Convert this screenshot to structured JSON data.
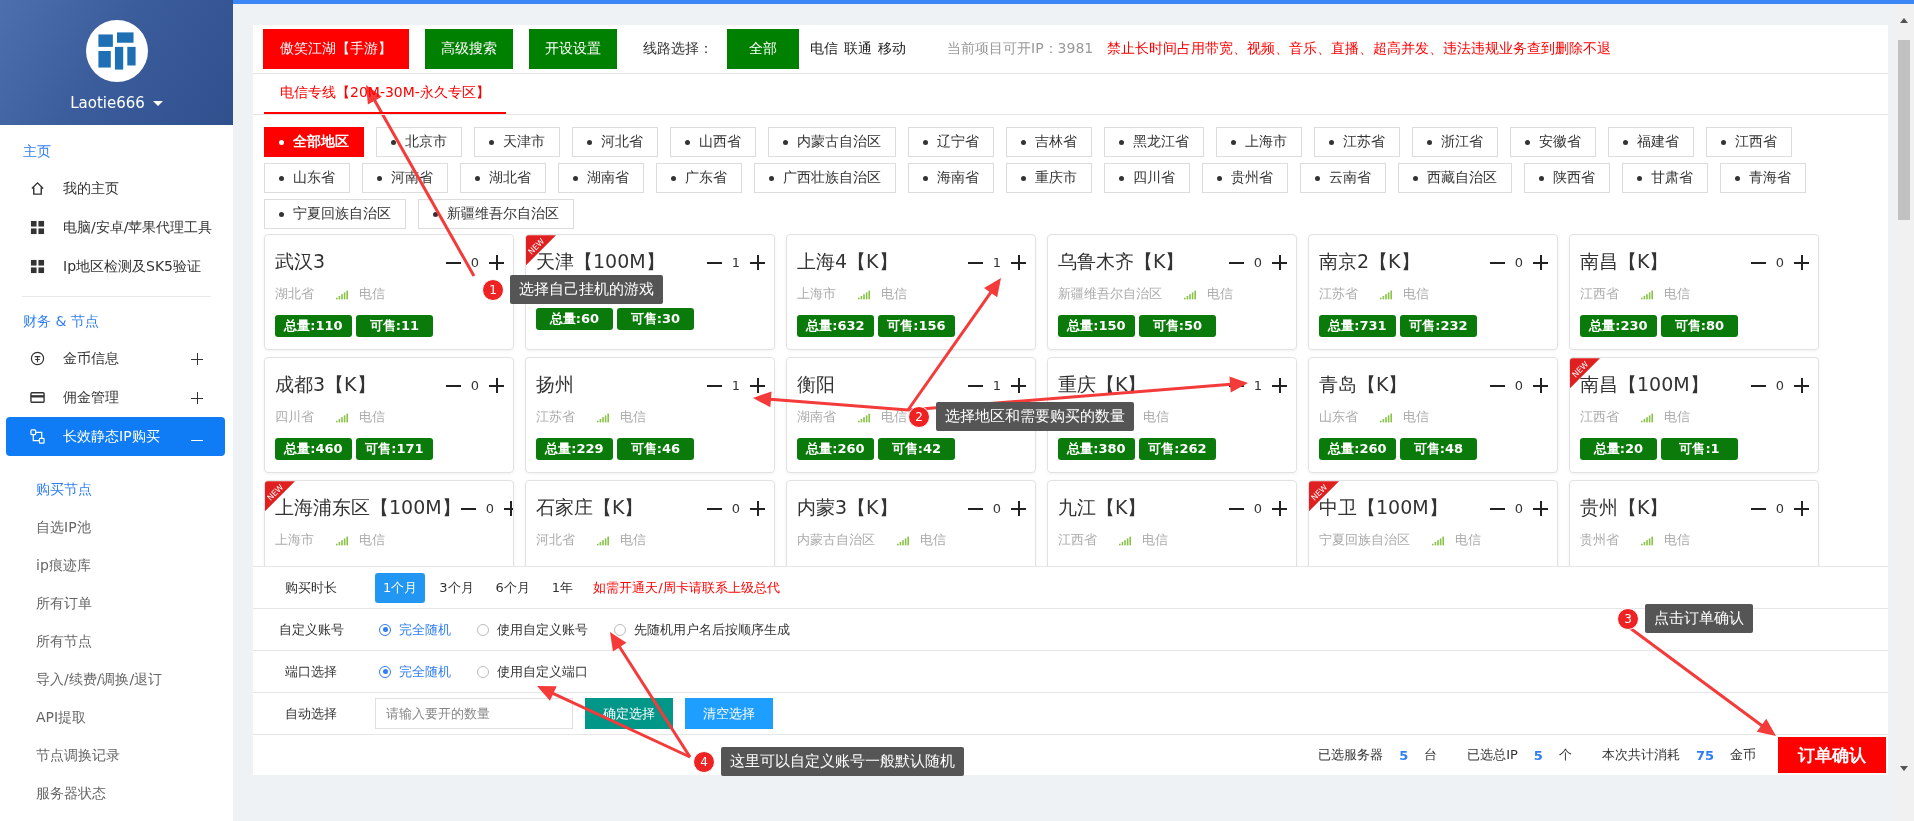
{
  "sidebar": {
    "username": "Laotie666",
    "sections": [
      {
        "title": "主页",
        "items": [
          {
            "label": "我的主页",
            "selected": false
          },
          {
            "label": "电脑/安卓/苹果代理工具",
            "selected": false
          },
          {
            "label": "Ip地区检测及SK5验证",
            "selected": false
          }
        ]
      },
      {
        "title": "财务 & 节点",
        "items": [
          {
            "label": "金币信息",
            "selected": false,
            "expanded": false
          },
          {
            "label": "佣金管理",
            "selected": false,
            "expanded": false
          },
          {
            "label": "长效静态IP购买",
            "selected": true,
            "expanded": true,
            "children": [
              {
                "label": "购买节点",
                "selected": true
              },
              {
                "label": "自选IP池",
                "selected": false
              },
              {
                "label": "ip痕迹库",
                "selected": false
              },
              {
                "label": "所有订单",
                "selected": false
              },
              {
                "label": "所有节点",
                "selected": false
              },
              {
                "label": "导入/续费/调换/退订",
                "selected": false
              },
              {
                "label": "API提取",
                "selected": false
              },
              {
                "label": "节点调换记录",
                "selected": false
              },
              {
                "label": "服务器状态",
                "selected": false
              }
            ]
          }
        ]
      }
    ]
  },
  "toolbar": {
    "game_button": "傲笑江湖【手游】",
    "buttons": [
      "高级搜索",
      "开设设置"
    ],
    "line_label": "线路选择：",
    "lines": [
      {
        "label": "全部",
        "selected": true
      },
      {
        "label": "电信",
        "selected": false
      },
      {
        "label": "联通",
        "selected": false
      },
      {
        "label": "移动",
        "selected": false
      }
    ],
    "info": "当前项目可开IP：3981",
    "warning": "禁止长时间占用带宽、视频、音乐、直播、超高并发、违法违规业务查到删除不退"
  },
  "tabs": [
    {
      "label": "电信专线【20M-30M-永久专区】",
      "selected": true
    }
  ],
  "region_rows": [
    {
      "tags": [
        {
          "label": "全部地区",
          "selected": true
        },
        {
          "label": "北京市",
          "selected": false
        },
        {
          "label": "天津市",
          "selected": false
        },
        {
          "label": "河北省",
          "selected": false
        },
        {
          "label": "山西省",
          "selected": false
        },
        {
          "label": "内蒙古自治区",
          "selected": false
        },
        {
          "label": "辽宁省",
          "selected": false
        },
        {
          "label": "吉林省",
          "selected": false
        },
        {
          "label": "黑龙江省",
          "selected": false
        },
        {
          "label": "上海市",
          "selected": false
        },
        {
          "label": "江苏省",
          "selected": false
        },
        {
          "label": "浙江省",
          "selected": false
        },
        {
          "label": "安徽省",
          "selected": false
        },
        {
          "label": "福建省",
          "selected": false
        },
        {
          "label": "江西省",
          "selected": false
        }
      ]
    },
    {
      "tags": [
        {
          "label": "山东省",
          "selected": false
        },
        {
          "label": "河南省",
          "selected": false
        },
        {
          "label": "湖北省",
          "selected": false
        },
        {
          "label": "湖南省",
          "selected": false
        },
        {
          "label": "广东省",
          "selected": false
        },
        {
          "label": "广西壮族自治区",
          "selected": false
        },
        {
          "label": "海南省",
          "selected": false
        },
        {
          "label": "重庆市",
          "selected": false
        },
        {
          "label": "四川省",
          "selected": false
        },
        {
          "label": "贵州省",
          "selected": false
        },
        {
          "label": "云南省",
          "selected": false
        },
        {
          "label": "西藏自治区",
          "selected": false
        },
        {
          "label": "陕西省",
          "selected": false
        },
        {
          "label": "甘肃省",
          "selected": false
        },
        {
          "label": "青海省",
          "selected": false
        }
      ]
    },
    {
      "tags": [
        {
          "label": "宁夏回族自治区",
          "selected": false
        },
        {
          "label": "新疆维吾尔自治区",
          "selected": false
        }
      ]
    }
  ],
  "nodes": [
    {
      "name": "武汉3",
      "province": "湖北省",
      "network": "电信",
      "count": "0",
      "total": "总量:110",
      "available": "可售:11"
    },
    {
      "name": "天津【100M】",
      "count": "1",
      "total": "总量:60",
      "available": "可售:30",
      "ribbon": "NEW"
    },
    {
      "name": "上海4【K】",
      "province": "上海市",
      "network": "电信",
      "count": "1",
      "total": "总量:632",
      "available": "可售:156"
    },
    {
      "name": "乌鲁木齐【K】",
      "province": "新疆维吾尔自治区",
      "network": "电信",
      "count": "0",
      "total": "总量:150",
      "available": "可售:50"
    },
    {
      "name": "南京2【K】",
      "province": "江苏省",
      "network": "电信",
      "count": "0",
      "total": "总量:731",
      "available": "可售:232"
    },
    {
      "name": "南昌【K】",
      "province": "江西省",
      "network": "电信",
      "count": "0",
      "total": "总量:230",
      "available": "可售:80"
    },
    {
      "name": "成都3【K】",
      "province": "四川省",
      "network": "电信",
      "count": "0",
      "total": "总量:460",
      "available": "可售:171"
    },
    {
      "name": "扬州",
      "province": "江苏省",
      "network": "电信",
      "count": "1",
      "total": "总量:229",
      "available": "可售:46"
    },
    {
      "name": "衡阳",
      "province": "湖南省",
      "network": "电信",
      "count": "1",
      "total": "总量:260",
      "available": "可售:42"
    },
    {
      "name": "重庆【K】",
      "network": "电信",
      "count": "1",
      "total": "总量:380",
      "available": "可售:262"
    },
    {
      "name": "青岛【K】",
      "province": "山东省",
      "network": "电信",
      "count": "0",
      "total": "总量:260",
      "available": "可售:48"
    },
    {
      "name": "南昌【100M】",
      "province": "江西省",
      "network": "电信",
      "count": "0",
      "total": "总量:20",
      "available": "可售:1",
      "ribbon": "NEW"
    },
    {
      "name": "上海浦东区【100M】",
      "province": "上海市",
      "network": "电信",
      "count": "0",
      "ribbon": "NEW"
    },
    {
      "name": "石家庄【K】",
      "province": "河北省",
      "network": "电信",
      "count": "0"
    },
    {
      "name": "内蒙3【K】",
      "province": "内蒙古自治区",
      "network": "电信",
      "count": "0"
    },
    {
      "name": "九江【K】",
      "province": "江西省",
      "network": "电信",
      "count": "0"
    },
    {
      "name": "中卫【100M】",
      "province": "宁夏回族自治区",
      "network": "电信",
      "count": "0",
      "ribbon": "NEW"
    },
    {
      "name": "贵州【K】",
      "province": "贵州省",
      "network": "电信",
      "count": "0"
    }
  ],
  "purchase": {
    "duration": {
      "label": "购买时长",
      "options": [
        {
          "label": "1个月",
          "selected": true
        },
        {
          "label": "3个月",
          "selected": false
        },
        {
          "label": "6个月",
          "selected": false
        },
        {
          "label": "1年",
          "selected": false
        }
      ],
      "note": "如需开通天/周卡请联系上级总代"
    },
    "account": {
      "label": "自定义账号",
      "options": [
        {
          "label": "完全随机",
          "selected": true
        },
        {
          "label": "使用自定义账号",
          "selected": false
        },
        {
          "label": "先随机用户名后按顺序生成",
          "selected": false
        }
      ]
    },
    "port": {
      "label": "端口选择",
      "options": [
        {
          "label": "完全随机",
          "selected": true
        },
        {
          "label": "使用自定义端口",
          "selected": false
        }
      ]
    },
    "auto": {
      "label": "自动选择",
      "placeholder": "请输入要开的数量",
      "confirm": "确定选择",
      "clear": "清空选择"
    }
  },
  "summary": {
    "servers_label": "已选服务器",
    "servers": "5",
    "servers_unit": "台",
    "ip_label": "已选总IP",
    "ips": "5",
    "ip_unit": "个",
    "cost_label": "本次共计消耗",
    "cost": "75",
    "cost_unit": "金币",
    "submit": "订单确认"
  },
  "annotations": [
    {
      "number": "1",
      "text": "选择自己挂机的游戏"
    },
    {
      "number": "2",
      "text": "选择地区和需要购买的数量"
    },
    {
      "number": "3",
      "text": "点击订单确认"
    },
    {
      "number": "4",
      "text": "这里可以自定义账号一般默认随机"
    }
  ]
}
